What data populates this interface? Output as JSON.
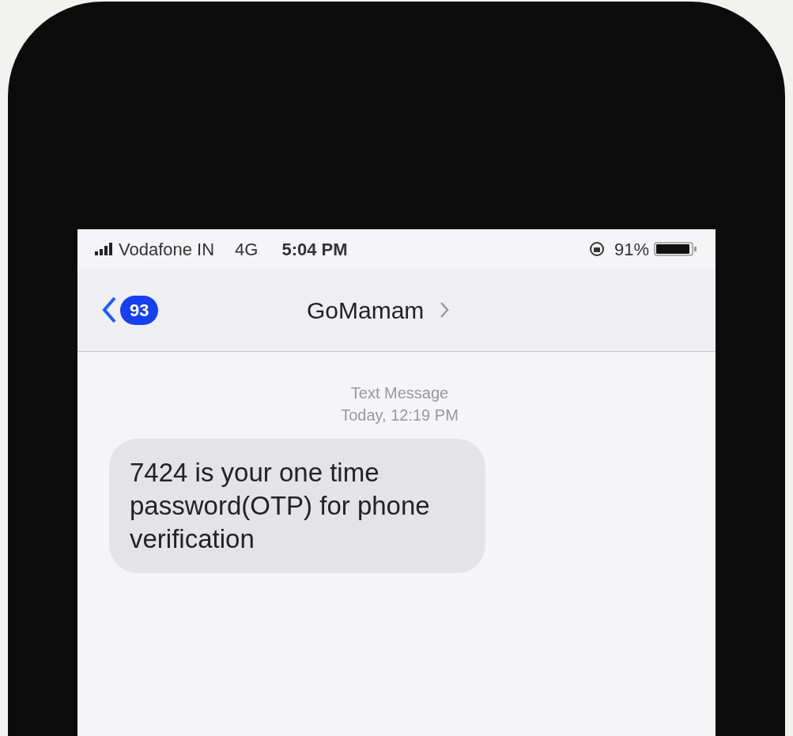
{
  "status_bar": {
    "carrier": "Vodafone IN",
    "network": "4G",
    "time": "5:04 PM",
    "battery_percent": "91%"
  },
  "nav_bar": {
    "unread_count": "93",
    "title": "GoMamam"
  },
  "conversation": {
    "meta_label": "Text Message",
    "meta_time": "Today, 12:19 PM",
    "messages": [
      {
        "kind": "incoming",
        "text": "7424 is your one time password(OTP) for phone verification"
      }
    ]
  }
}
